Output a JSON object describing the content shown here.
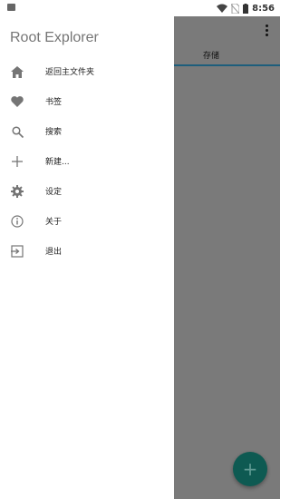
{
  "status_bar": {
    "time": "8:56",
    "icons": [
      "gallery-icon",
      "wifi-icon",
      "no-sim-icon",
      "battery-icon"
    ]
  },
  "drawer": {
    "title": "Root Explorer",
    "items": [
      {
        "label": "返回主文件夹",
        "icon": "home-icon"
      },
      {
        "label": "书签",
        "icon": "heart-icon"
      },
      {
        "label": "搜索",
        "icon": "search-icon"
      },
      {
        "label": "新建...",
        "icon": "plus-icon"
      },
      {
        "label": "设定",
        "icon": "gear-icon"
      },
      {
        "label": "关于",
        "icon": "info-icon"
      },
      {
        "label": "退出",
        "icon": "exit-icon"
      }
    ]
  },
  "background_app": {
    "tab_label": "存储",
    "fab_symbol": "+",
    "colors": {
      "scrim": "#7a7a7a",
      "tab_indicator": "#1d5e7c",
      "fab": "#0e5a52"
    }
  }
}
